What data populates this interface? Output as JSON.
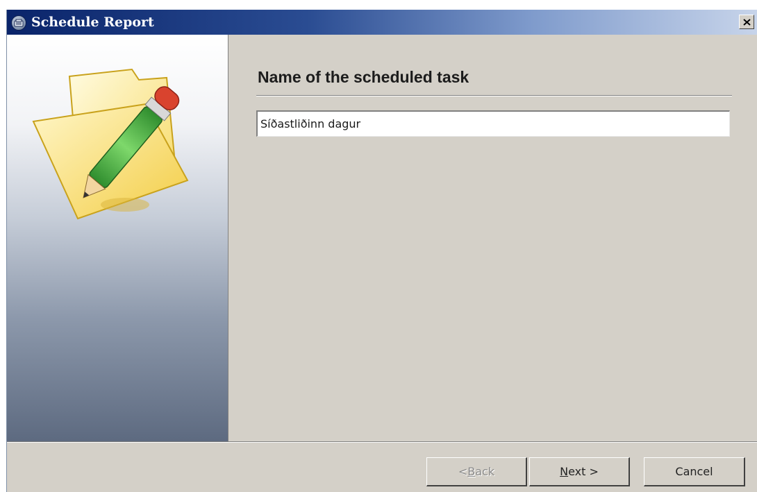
{
  "window": {
    "title": "Schedule Report"
  },
  "titlebar": {
    "app_icon": "report-app-icon",
    "close_icon": "close-icon"
  },
  "sidebar": {
    "illustration": "folder-pencil-illustration"
  },
  "main": {
    "heading": "Name of the scheduled task",
    "task_name_value": "Síðastliðinn dagur"
  },
  "footer": {
    "back": {
      "prefix": "< ",
      "mnemonic": "B",
      "rest": "ack",
      "enabled": false
    },
    "next": {
      "mnemonic": "N",
      "rest": "ext >",
      "enabled": true
    },
    "cancel": {
      "label": "Cancel",
      "enabled": true
    }
  },
  "colors": {
    "titlebar_start": "#0a246a",
    "titlebar_end": "#c7d4ea",
    "dialog_face": "#d4d0c8",
    "folder_yellow": "#fde88a",
    "pencil_green": "#4cb84a",
    "eraser_red": "#d9432e"
  }
}
